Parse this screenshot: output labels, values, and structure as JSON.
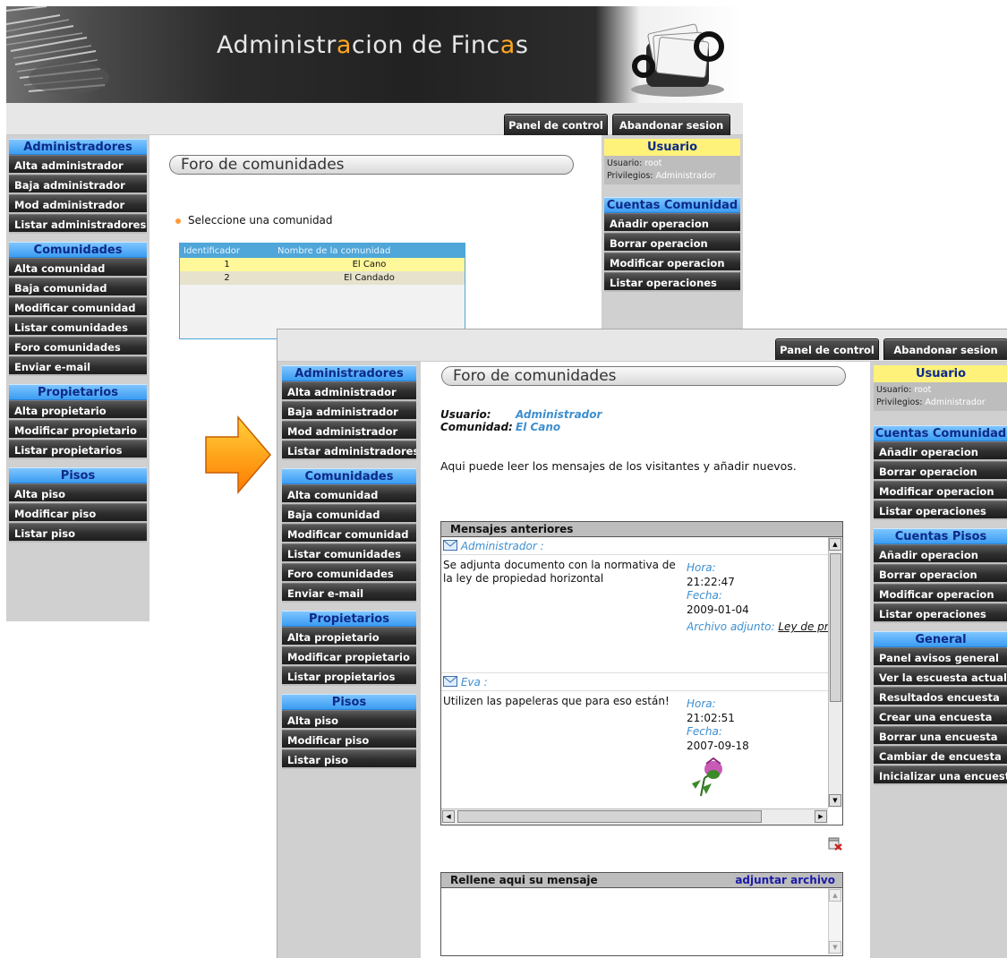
{
  "back": {
    "banner_title_parts": [
      "Administr",
      "a",
      "cion de Finc",
      "a",
      "s"
    ],
    "tabs": {
      "panel": "Panel de control",
      "logout": "Abandonar sesion"
    },
    "page_title": "Foro de comunidades",
    "select_prompt": "Seleccione una comunidad",
    "table": {
      "headers": [
        "Identificador",
        "Nombre de la comunidad"
      ],
      "rows": [
        [
          "1",
          "El Cano"
        ],
        [
          "2",
          "El Candado"
        ]
      ]
    },
    "left_nav": [
      {
        "head": "Administradores",
        "items": [
          "Alta administrador",
          "Baja administrador",
          "Mod administrador",
          "Listar administradores"
        ]
      },
      {
        "head": "Comunidades",
        "items": [
          "Alta comunidad",
          "Baja comunidad",
          "Modificar comunidad",
          "Listar comunidades",
          "Foro comunidades",
          "Enviar e-mail"
        ]
      },
      {
        "head": "Propietarios",
        "items": [
          "Alta propietario",
          "Modificar propietario",
          "Listar propietarios"
        ]
      },
      {
        "head": "Pisos",
        "items": [
          "Alta piso",
          "Modificar piso",
          "Listar piso"
        ]
      }
    ],
    "user": {
      "head": "Usuario",
      "user_label": "Usuario:",
      "user_value": "root",
      "priv_label": "Privilegios:",
      "priv_value": "Administrador"
    },
    "right_nav": [
      {
        "head": "Cuentas Comunidad",
        "items": [
          "Añadir operacion",
          "Borrar operacion",
          "Modificar operacion",
          "Listar operaciones"
        ]
      }
    ]
  },
  "front": {
    "tabs": {
      "panel": "Panel de control",
      "logout": "Abandonar sesion"
    },
    "page_title": "Foro de comunidades",
    "user_label": "Usuario:",
    "user_value": "Administrador",
    "community_label": "Comunidad:",
    "community_value": "El Cano",
    "intro": "Aqui puede leer los mensajes de los visitantes y añadir nuevos.",
    "messages_header": "Mensajes anteriores",
    "messages": [
      {
        "author": "Administrador :",
        "text": "Se adjunta documento con la normativa de la ley de propiedad horizontal",
        "hora_label": "Hora:",
        "hora": "21:22:47",
        "fecha_label": "Fecha:",
        "fecha": "2009-01-04",
        "attach_label": "Archivo adjunto:",
        "attach_file": "Ley de pro horizontal.pdf"
      },
      {
        "author": "Eva :",
        "text": "Utilizen las papeleras que para eso están!",
        "hora_label": "Hora:",
        "hora": "21:02:51",
        "fecha_label": "Fecha:",
        "fecha": "2007-09-18"
      }
    ],
    "compose_header": "Rellene aqui su mensaje",
    "attach_link": "adjuntar archivo",
    "left_nav": [
      {
        "head": "Administradores",
        "items": [
          "Alta administrador",
          "Baja administrador",
          "Mod administrador",
          "Listar administradores"
        ]
      },
      {
        "head": "Comunidades",
        "items": [
          "Alta comunidad",
          "Baja comunidad",
          "Modificar comunidad",
          "Listar comunidades",
          "Foro comunidades",
          "Enviar e-mail"
        ]
      },
      {
        "head": "Propietarios",
        "items": [
          "Alta propietario",
          "Modificar propietario",
          "Listar propietarios"
        ]
      },
      {
        "head": "Pisos",
        "items": [
          "Alta piso",
          "Modificar piso",
          "Listar piso"
        ]
      }
    ],
    "user": {
      "head": "Usuario",
      "user_label": "Usuario:",
      "user_value": "root",
      "priv_label": "Privilegios:",
      "priv_value": "Administrador"
    },
    "right_nav": [
      {
        "head": "Cuentas Comunidad",
        "items": [
          "Añadir operacion",
          "Borrar operacion",
          "Modificar operacion",
          "Listar operaciones"
        ]
      },
      {
        "head": "Cuentas Pisos",
        "items": [
          "Añadir operacion",
          "Borrar operacion",
          "Modificar operacion",
          "Listar operaciones"
        ]
      },
      {
        "head": "General",
        "items": [
          "Panel avisos general",
          "Ver la escuesta actual",
          "Resultados encuesta",
          "Crear una encuesta",
          "Borrar una encuesta",
          "Cambiar de encuesta",
          "Inicializar una encuesta"
        ]
      }
    ]
  },
  "colors": {
    "nav_head": "#3b9cf2",
    "nav_button": "#2d2d2d",
    "accent_orange": "#ffa620",
    "link_blue": "#3d8fd0",
    "arrow": "#ff9800"
  }
}
